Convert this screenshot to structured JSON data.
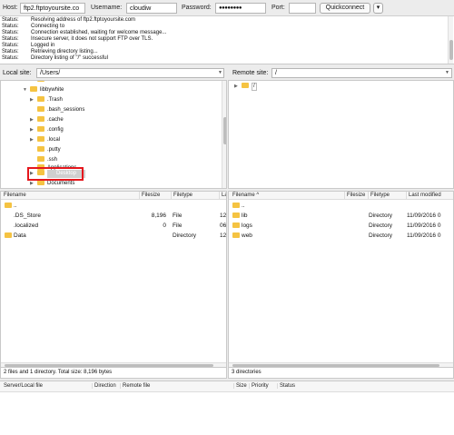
{
  "quickconnect": {
    "host_label": "Host:",
    "host_value": "ftp2.ftptoyoursite.co",
    "username_label": "Username:",
    "username_value": "cloudiw",
    "password_label": "Password:",
    "password_value": "●●●●●●●●",
    "port_label": "Port:",
    "port_value": "",
    "connect_label": "Quickconnect",
    "dropdown_glyph": "▾"
  },
  "log": [
    {
      "status": "Status:",
      "message": "Resolving address of ftp2.ftptoyoursite.com"
    },
    {
      "status": "Status:",
      "message": "Connecting to"
    },
    {
      "status": "Status:",
      "message": "Connection established, waiting for welcome message..."
    },
    {
      "status": "Status:",
      "message": "Insecure server, it does not support FTP over TLS."
    },
    {
      "status": "Status:",
      "message": "Logged in"
    },
    {
      "status": "Status:",
      "message": "Retrieving directory listing..."
    },
    {
      "status": "Status:",
      "message": "Directory listing of \"/\" successful"
    }
  ],
  "local": {
    "site_label": "Local site:",
    "site_path": "/Users/",
    "tree": [
      {
        "name": "shared",
        "expand": "",
        "partial": true
      },
      {
        "name": "libbywhite",
        "expand": "▼"
      },
      {
        "name": ".Trash",
        "expand": "▶"
      },
      {
        "name": ".bash_sessions",
        "expand": ""
      },
      {
        "name": ".cache",
        "expand": "▶"
      },
      {
        "name": ".config",
        "expand": "▶"
      },
      {
        "name": ".local",
        "expand": "▶"
      },
      {
        "name": ".putty",
        "expand": ""
      },
      {
        "name": ".ssh",
        "expand": ""
      },
      {
        "name": "Applications",
        "expand": ""
      },
      {
        "name": "Desktop",
        "expand": "▶",
        "selected": true
      },
      {
        "name": "Documents",
        "expand": "▶"
      }
    ],
    "columns": [
      "Filename",
      "Filesize",
      "Filetype",
      "La"
    ],
    "files": [
      {
        "name": "..",
        "size": "",
        "type": "",
        "modified": "",
        "folder": true
      },
      {
        "name": ".DS_Store",
        "size": "8,196",
        "type": "File",
        "modified": "12",
        "folder": false
      },
      {
        "name": ".localized",
        "size": "0",
        "type": "File",
        "modified": "06",
        "folder": false
      },
      {
        "name": "Data",
        "size": "",
        "type": "Directory",
        "modified": "12",
        "folder": true
      }
    ],
    "status": "2 files and 1 directory. Total size: 8,196 bytes"
  },
  "remote": {
    "site_label": "Remote site:",
    "site_path": "/",
    "tree": [
      {
        "name": "/",
        "expand": "▶"
      }
    ],
    "columns": [
      "Filename",
      "Filesize",
      "Filetype",
      "Last modified"
    ],
    "sort_glyph": "^",
    "files": [
      {
        "name": "..",
        "size": "",
        "type": "",
        "modified": "",
        "folder": true
      },
      {
        "name": "lib",
        "size": "",
        "type": "Directory",
        "modified": "11/09/2016 0",
        "folder": true
      },
      {
        "name": "logs",
        "size": "",
        "type": "Directory",
        "modified": "11/09/2016 0",
        "folder": true
      },
      {
        "name": "web",
        "size": "",
        "type": "Directory",
        "modified": "11/09/2016 0",
        "folder": true
      }
    ],
    "status": "3 directories"
  },
  "queue": {
    "columns": [
      "Server/Local file",
      "Direction",
      "Remote file",
      "Size",
      "Priority",
      "Status"
    ]
  },
  "colors": {
    "folder": "#f5c342",
    "highlight_box": "#e5161c",
    "selection": "#cfcfcf"
  }
}
